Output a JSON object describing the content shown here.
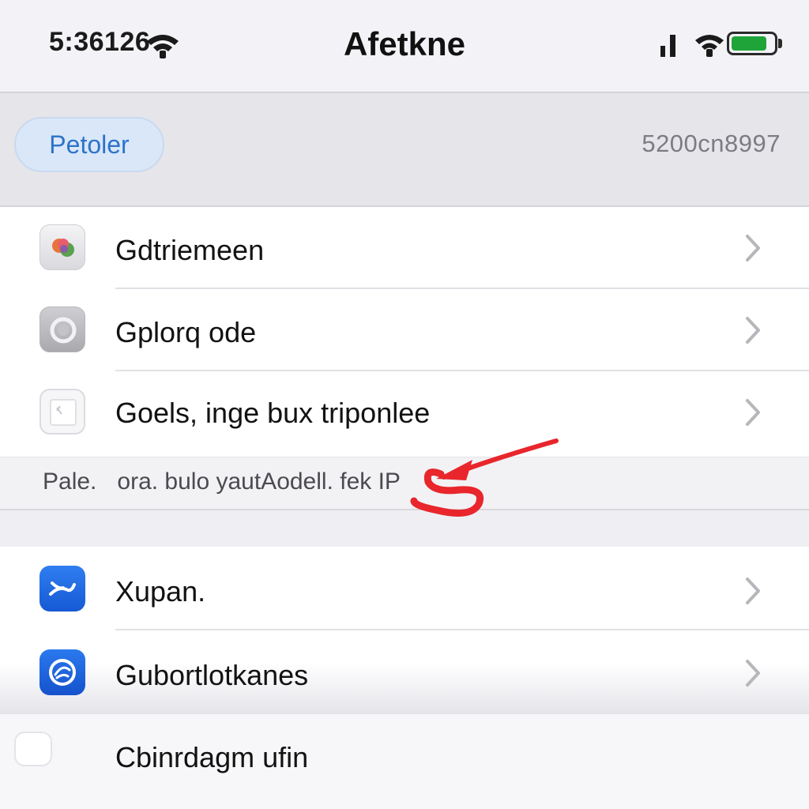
{
  "status_bar": {
    "time": "5:36126",
    "title": "Afetkne",
    "battery_level": 0.85,
    "battery_color": "#1fa43a",
    "icons": [
      "wifi-icon",
      "signal-icon",
      "wifi-icon",
      "battery-icon"
    ]
  },
  "header": {
    "button_label": "Petoler",
    "value": "5200cn8997"
  },
  "group1": {
    "rows": [
      {
        "label": "Gdtriemeen",
        "icon": "app-icon-colorful"
      },
      {
        "label": "Gplorq ode",
        "icon": "settings-ring-icon"
      },
      {
        "label": "Goels, inge bux triponlee",
        "icon": "document-icon"
      }
    ]
  },
  "footer_note": {
    "prefix": "Pale.",
    "text": "ora. bulo yautAodell. fek IP"
  },
  "group2": {
    "rows": [
      {
        "label": "Xupan.",
        "icon": "blue-app-icon"
      },
      {
        "label": "Gubortlotkanes",
        "icon": "blue-circle-app-icon"
      },
      {
        "label": "Cbinrdagm ufin",
        "icon": "blank-app-icon"
      }
    ]
  },
  "colors": {
    "accent_blue": "#2d73c9",
    "annotation_red": "#e8262c",
    "background": "#efeff3"
  }
}
